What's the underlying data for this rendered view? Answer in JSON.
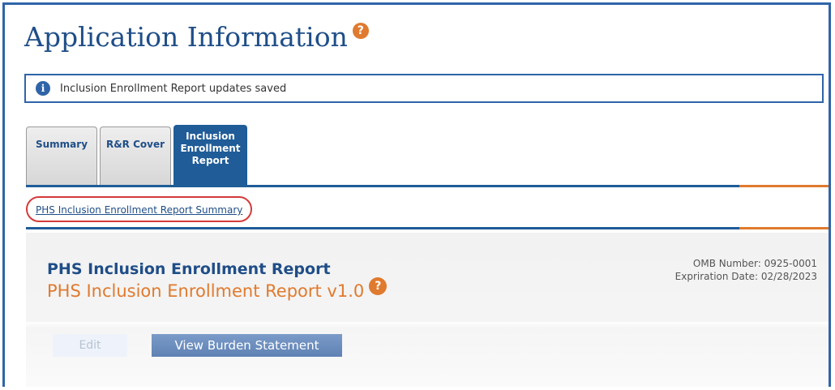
{
  "page": {
    "title": "Application Information",
    "title_help_icon": "?"
  },
  "notice": {
    "icon": "i",
    "message": "Inclusion Enrollment Report updates saved"
  },
  "tabs": [
    {
      "label": "Summary",
      "active": false
    },
    {
      "label": "R&R Cover",
      "active": false
    },
    {
      "label": "Inclusion\nEnrollment\nReport",
      "active": true
    }
  ],
  "subnav": {
    "link": "PHS Inclusion Enrollment Report Summary"
  },
  "form": {
    "title": "PHS Inclusion Enrollment Report",
    "subtitle": "PHS Inclusion Enrollment Report v1.0",
    "help_icon": "?",
    "omb_number": "OMB Number: 0925-0001",
    "expiration": "Expriration Date: 02/28/2023"
  },
  "buttons": {
    "edit": "Edit",
    "view_burden": "View Burden Statement"
  },
  "colors": {
    "accent_blue": "#1f5c98",
    "accent_orange": "#e07a2e",
    "highlight_red": "#d43a3a"
  }
}
